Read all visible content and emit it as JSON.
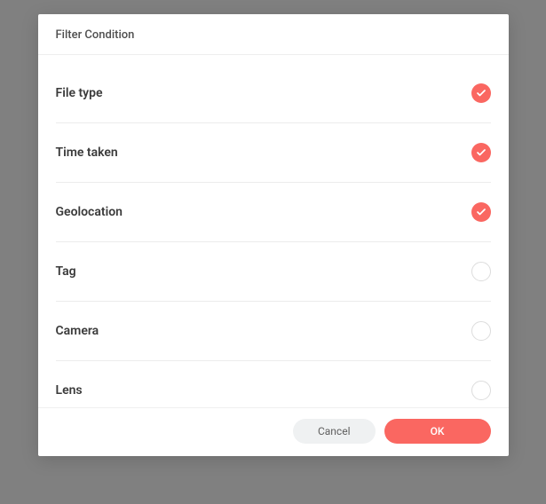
{
  "modal": {
    "title": "Filter Condition",
    "items": [
      {
        "label": "File type",
        "checked": true
      },
      {
        "label": "Time taken",
        "checked": true
      },
      {
        "label": "Geolocation",
        "checked": true
      },
      {
        "label": "Tag",
        "checked": false
      },
      {
        "label": "Camera",
        "checked": false
      },
      {
        "label": "Lens",
        "checked": false
      }
    ],
    "cancel_label": "Cancel",
    "ok_label": "OK"
  },
  "colors": {
    "accent": "#FA6761",
    "cancel_bg": "#eff1f2"
  }
}
